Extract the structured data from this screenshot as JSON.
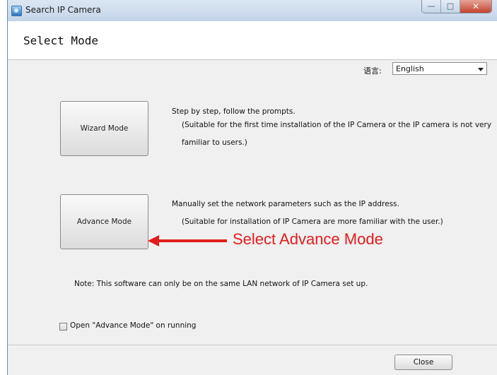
{
  "window": {
    "title": "Search IP Camera"
  },
  "page": {
    "title": "Select Mode"
  },
  "language": {
    "label": "语言:",
    "value": "English"
  },
  "wizard": {
    "button_label": "Wizard Mode",
    "desc_line1": "Step by step, follow the prompts.",
    "desc_line2": "(Suitable for the first time installation of the IP Camera or the IP camera is not very",
    "desc_line3": "familiar to users.)"
  },
  "advance": {
    "button_label": "Advance Mode",
    "desc_line1": "Manually set the network parameters such as the IP address.",
    "desc_line2": "(Suitable for installation of IP Camera are more familiar with the user.)"
  },
  "annotation": {
    "text": "Select Advance Mode",
    "color": "#e41c1c"
  },
  "note": "Note: This software can only be on the same LAN network of IP Camera set up.",
  "option": {
    "label": "Open \"Advance Mode\" on running",
    "checked": false
  },
  "footer": {
    "close_label": "Close"
  }
}
